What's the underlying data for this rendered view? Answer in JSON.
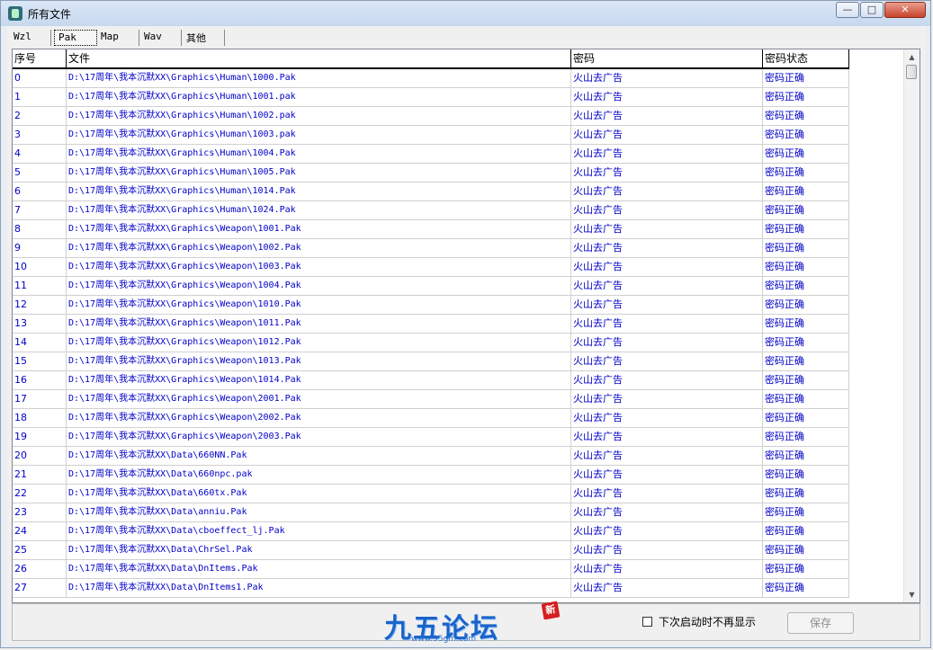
{
  "window": {
    "title": "所有文件",
    "min_label": "—",
    "max_label": "□",
    "close_label": "✕"
  },
  "tabs": [
    {
      "label": "Wzl",
      "active": false
    },
    {
      "label": "Pak",
      "active": true
    },
    {
      "label": "Map",
      "active": false
    },
    {
      "label": "Wav",
      "active": false
    },
    {
      "label": "其他",
      "active": false
    }
  ],
  "table": {
    "columns": [
      "序号",
      "文件",
      "密码",
      "密码状态"
    ],
    "rows": [
      [
        "0",
        "D:\\17周年\\我本沉默XX\\Graphics\\Human\\1000.Pak",
        "火山去广告",
        "密码正确"
      ],
      [
        "1",
        "D:\\17周年\\我本沉默XX\\Graphics\\Human\\1001.pak",
        "火山去广告",
        "密码正确"
      ],
      [
        "2",
        "D:\\17周年\\我本沉默XX\\Graphics\\Human\\1002.pak",
        "火山去广告",
        "密码正确"
      ],
      [
        "3",
        "D:\\17周年\\我本沉默XX\\Graphics\\Human\\1003.pak",
        "火山去广告",
        "密码正确"
      ],
      [
        "4",
        "D:\\17周年\\我本沉默XX\\Graphics\\Human\\1004.Pak",
        "火山去广告",
        "密码正确"
      ],
      [
        "5",
        "D:\\17周年\\我本沉默XX\\Graphics\\Human\\1005.Pak",
        "火山去广告",
        "密码正确"
      ],
      [
        "6",
        "D:\\17周年\\我本沉默XX\\Graphics\\Human\\1014.Pak",
        "火山去广告",
        "密码正确"
      ],
      [
        "7",
        "D:\\17周年\\我本沉默XX\\Graphics\\Human\\1024.Pak",
        "火山去广告",
        "密码正确"
      ],
      [
        "8",
        "D:\\17周年\\我本沉默XX\\Graphics\\Weapon\\1001.Pak",
        "火山去广告",
        "密码正确"
      ],
      [
        "9",
        "D:\\17周年\\我本沉默XX\\Graphics\\Weapon\\1002.Pak",
        "火山去广告",
        "密码正确"
      ],
      [
        "10",
        "D:\\17周年\\我本沉默XX\\Graphics\\Weapon\\1003.Pak",
        "火山去广告",
        "密码正确"
      ],
      [
        "11",
        "D:\\17周年\\我本沉默XX\\Graphics\\Weapon\\1004.Pak",
        "火山去广告",
        "密码正确"
      ],
      [
        "12",
        "D:\\17周年\\我本沉默XX\\Graphics\\Weapon\\1010.Pak",
        "火山去广告",
        "密码正确"
      ],
      [
        "13",
        "D:\\17周年\\我本沉默XX\\Graphics\\Weapon\\1011.Pak",
        "火山去广告",
        "密码正确"
      ],
      [
        "14",
        "D:\\17周年\\我本沉默XX\\Graphics\\Weapon\\1012.Pak",
        "火山去广告",
        "密码正确"
      ],
      [
        "15",
        "D:\\17周年\\我本沉默XX\\Graphics\\Weapon\\1013.Pak",
        "火山去广告",
        "密码正确"
      ],
      [
        "16",
        "D:\\17周年\\我本沉默XX\\Graphics\\Weapon\\1014.Pak",
        "火山去广告",
        "密码正确"
      ],
      [
        "17",
        "D:\\17周年\\我本沉默XX\\Graphics\\Weapon\\2001.Pak",
        "火山去广告",
        "密码正确"
      ],
      [
        "18",
        "D:\\17周年\\我本沉默XX\\Graphics\\Weapon\\2002.Pak",
        "火山去广告",
        "密码正确"
      ],
      [
        "19",
        "D:\\17周年\\我本沉默XX\\Graphics\\Weapon\\2003.Pak",
        "火山去广告",
        "密码正确"
      ],
      [
        "20",
        "D:\\17周年\\我本沉默XX\\Data\\660NN.Pak",
        "火山去广告",
        "密码正确"
      ],
      [
        "21",
        "D:\\17周年\\我本沉默XX\\Data\\660npc.pak",
        "火山去广告",
        "密码正确"
      ],
      [
        "22",
        "D:\\17周年\\我本沉默XX\\Data\\660tx.Pak",
        "火山去广告",
        "密码正确"
      ],
      [
        "23",
        "D:\\17周年\\我本沉默XX\\Data\\anniu.Pak",
        "火山去广告",
        "密码正确"
      ],
      [
        "24",
        "D:\\17周年\\我本沉默XX\\Data\\cboeffect_lj.Pak",
        "火山去广告",
        "密码正确"
      ],
      [
        "25",
        "D:\\17周年\\我本沉默XX\\Data\\ChrSel.Pak",
        "火山去广告",
        "密码正确"
      ],
      [
        "26",
        "D:\\17周年\\我本沉默XX\\Data\\DnItems.Pak",
        "火山去广告",
        "密码正确"
      ],
      [
        "27",
        "D:\\17周年\\我本沉默XX\\Data\\DnItems1.Pak",
        "火山去广告",
        "密码正确"
      ]
    ]
  },
  "footer": {
    "logo_text": "九五论坛",
    "logo_url_text": "www.95gm.com",
    "logo_badge": "新",
    "checkbox_label": "下次启动时不再显示",
    "save_label": "保存"
  },
  "scrollbar": {
    "up_arrow": "▲",
    "down_arrow": "▼"
  }
}
